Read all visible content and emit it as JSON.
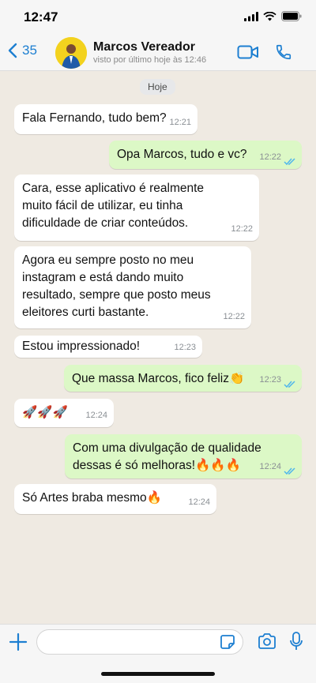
{
  "status_bar": {
    "time": "12:47"
  },
  "header": {
    "back_count": "35",
    "contact_name": "Marcos Vereador",
    "contact_status": "visto por último hoje às 12:46"
  },
  "chat": {
    "day_label": "Hoje",
    "messages": [
      {
        "direction": "in",
        "lines": [
          "Fala Fernando, tudo bem?"
        ],
        "time": "12:21"
      },
      {
        "direction": "out",
        "lines": [
          "Opa Marcos, tudo e vc?"
        ],
        "time": "12:22",
        "status": "read"
      },
      {
        "direction": "in",
        "lines": [
          "Cara, esse aplicativo é realmente",
          "muito fácil de utilizar, eu tinha",
          "dificuldade de criar conteúdos."
        ],
        "time": "12:22"
      },
      {
        "direction": "in",
        "lines": [
          "Agora eu sempre posto no meu",
          "instagram e está dando muito",
          "resultado, sempre que posto meus",
          "eleitores curti bastante."
        ],
        "time": "12:22"
      },
      {
        "direction": "in",
        "lines": [
          "Estou impressionado!"
        ],
        "time": "12:23"
      },
      {
        "direction": "out",
        "lines": [
          "Que massa Marcos, fico feliz👏"
        ],
        "time": "12:23",
        "status": "read"
      },
      {
        "direction": "in",
        "lines": [
          "🚀🚀🚀"
        ],
        "time": "12:24"
      },
      {
        "direction": "out",
        "lines": [
          "Com uma divulgação de qualidade",
          "dessas é só melhoras!🔥🔥🔥"
        ],
        "time": "12:24",
        "status": "read"
      },
      {
        "direction": "in",
        "lines": [
          "Só Artes braba mesmo🔥"
        ],
        "time": "12:24"
      }
    ]
  },
  "input_bar": {
    "placeholder": ""
  },
  "colors": {
    "accent": "#1d7fd1",
    "chat_background": "#efeae2",
    "outgoing_bubble": "#dcf8c6",
    "incoming_bubble": "#ffffff",
    "read_ticks": "#4fb6ec"
  },
  "icons": {
    "back": "chevron-left-icon",
    "video": "video-camera-icon",
    "call": "phone-icon",
    "plus": "plus-icon",
    "sticker": "sticker-icon",
    "camera": "camera-icon",
    "mic": "microphone-icon",
    "ticks": "double-check-icon"
  }
}
